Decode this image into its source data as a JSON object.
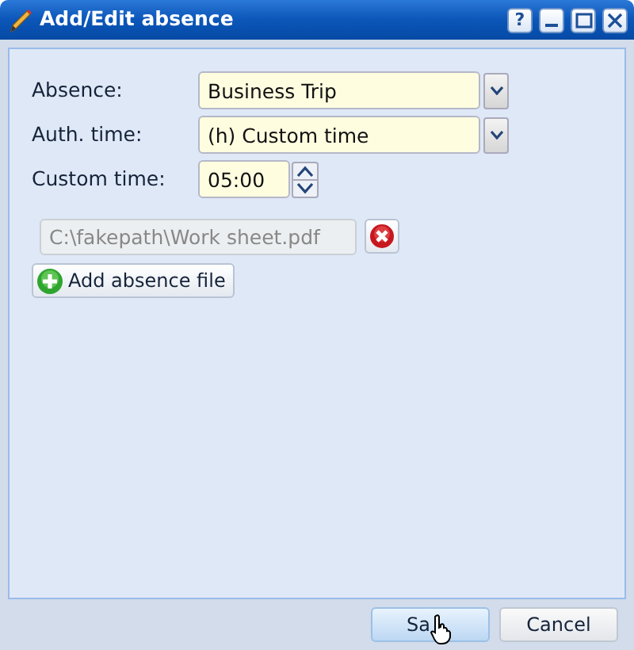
{
  "window": {
    "title": "Add/Edit absence",
    "help_button": "?"
  },
  "fields": [
    {
      "kind": "select",
      "label": "Absence:",
      "value": "Business Trip"
    },
    {
      "kind": "select",
      "label": "Auth. time:",
      "value": "(h) Custom time"
    },
    {
      "kind": "spinner",
      "label": "Custom time:",
      "value": "05:00"
    }
  ],
  "file": {
    "value": "C:\\fakepath\\Work sheet.pdf",
    "disabled": true
  },
  "add_file_button": "Add absence file",
  "buttons": [
    {
      "label": "Sa",
      "hovered": true,
      "cursor": true
    },
    {
      "label": "Cancel",
      "hovered": false,
      "cursor": false
    }
  ]
}
